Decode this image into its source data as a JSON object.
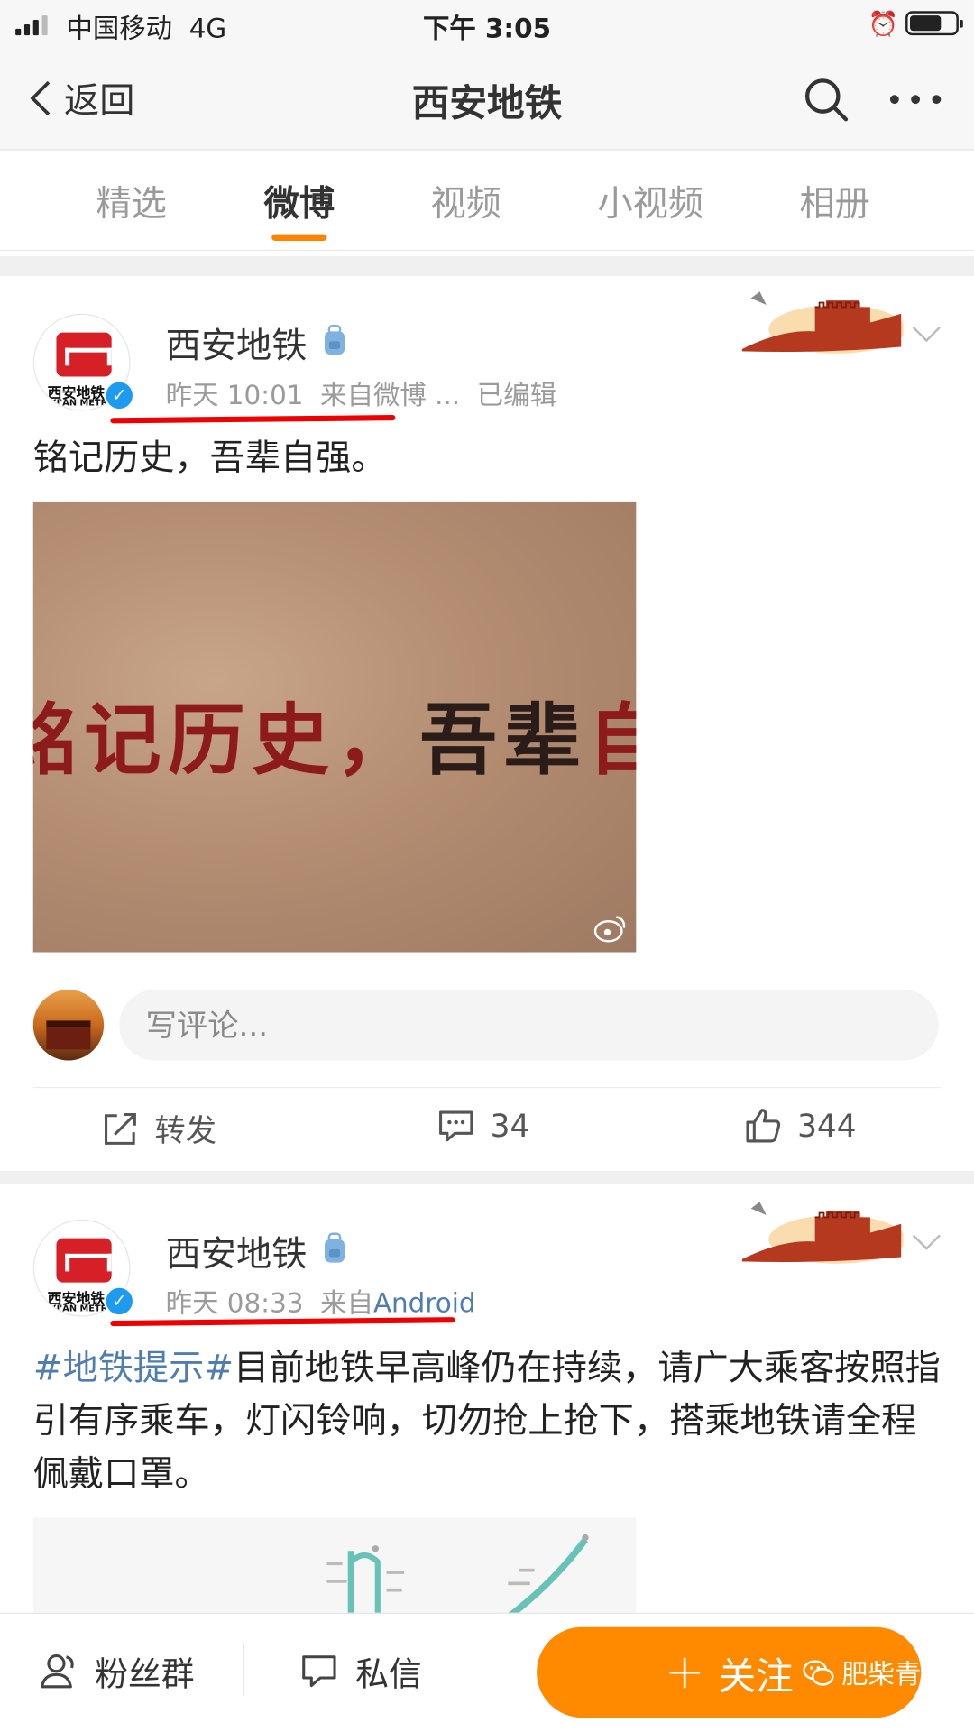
{
  "status_bar": {
    "carrier": "中国移动",
    "network": "4G",
    "time": "下午 3:05"
  },
  "nav": {
    "back_label": "返回",
    "title": "西安地铁"
  },
  "tabs": [
    {
      "label": "精选"
    },
    {
      "label": "微博"
    },
    {
      "label": "视频"
    },
    {
      "label": "小视频"
    },
    {
      "label": "相册"
    }
  ],
  "active_tab": "微博",
  "posts": [
    {
      "user": "西安地铁",
      "avatar_cn": "西安地铁",
      "avatar_en": "XI'AN METRO",
      "time": "昨天 10:01",
      "source_prefix": "来自",
      "source": "微博 ...",
      "edited": "已编辑",
      "text": "铭记历史，吾辈自强。",
      "image_text_red_1": "铭记历史，",
      "image_text_dark": "吾辈",
      "image_text_red_2": "自强",
      "comment_placeholder": "写评论...",
      "repost_label": "转发",
      "comments": "34",
      "likes": "344"
    },
    {
      "user": "西安地铁",
      "avatar_cn": "西安地铁",
      "avatar_en": "XI'AN METRO",
      "time": "昨天 08:33",
      "source_prefix": "来自",
      "source": "Android",
      "hashtag": "#地铁提示#",
      "text": "目前地铁早高峰仍在持续，请广大乘客按照指引有序乘车，灯闪铃响，切勿抢上抢下，搭乘地铁请全程佩戴口罩。"
    }
  ],
  "bottom_bar": {
    "fans_label": "粉丝群",
    "message_label": "私信",
    "follow_label": "关注"
  },
  "watermark": "肥柴青年",
  "colors": {
    "accent": "#ff8200",
    "link": "#507daf",
    "verified": "#1d9bf0",
    "brand_red": "#d71f27",
    "annotation_red": "#e00000"
  }
}
